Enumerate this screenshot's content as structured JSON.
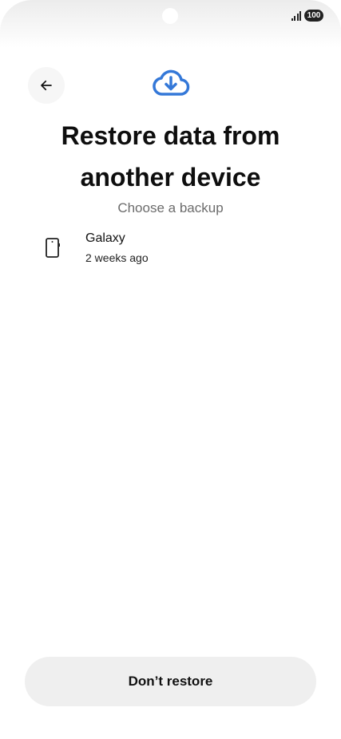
{
  "status_bar": {
    "battery_level": "100"
  },
  "header": {
    "back_icon": "arrow-left-icon",
    "hero_icon": "cloud-download-icon",
    "accent_color": "#3478d8",
    "title_line1": "Restore data from",
    "title_line2": "another device",
    "subtitle": "Choose a backup"
  },
  "backups": [
    {
      "icon": "phone-icon",
      "name": "Galaxy",
      "time": "2 weeks ago"
    }
  ],
  "footer": {
    "dont_restore_label": "Don’t restore"
  }
}
